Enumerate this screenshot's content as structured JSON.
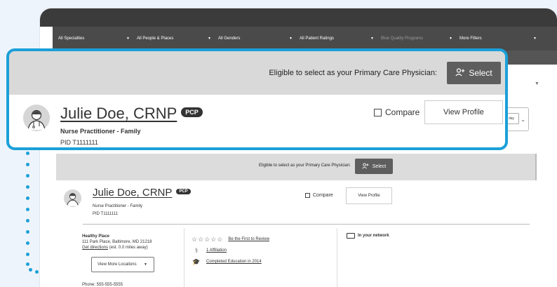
{
  "filters": [
    {
      "label": "All Specialties"
    },
    {
      "label": "All People & Places"
    },
    {
      "label": "All Genders"
    },
    {
      "label": "All Patient Ratings"
    },
    {
      "label": "Blue Quality Programs"
    },
    {
      "label": "More Filters"
    }
  ],
  "pcp_prompt": "Eligible to select as your Primary Care Physician:",
  "select_label": "Select",
  "provider": {
    "name": "Julie Doe, CRNP",
    "badge": "PCP",
    "specialty": "Nurse Practitioner - Family",
    "pid": "PID T1111111"
  },
  "compare_label": "Compare",
  "view_profile_label": "View Profile",
  "peek_day": "day",
  "location": {
    "name": "Healthy Place",
    "address": "111 Park Place, Baltimore, MD 21218",
    "directions_link": "Get directions",
    "distance": "(est. 0.0 miles away)",
    "more_locations": "View More Locations",
    "phone": "Phone: 555-555-5555"
  },
  "reviews_link": "Be the First to Review",
  "affiliation_link": "1 Affiliation",
  "education_link": "Completed Education in 2014",
  "network_label": "In your network",
  "colors": {
    "accent": "#1ca0d8",
    "button": "#5e5e5e",
    "band": "#d9d9d9"
  }
}
